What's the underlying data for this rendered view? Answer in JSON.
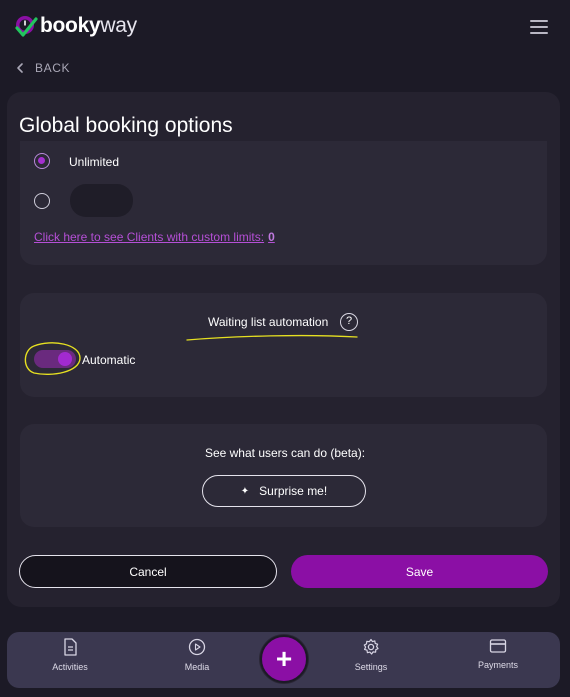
{
  "header": {
    "logo_bold": "booky",
    "logo_light": "way",
    "menu_icon": "hamburger-icon"
  },
  "nav": {
    "back_label": "BACK"
  },
  "page": {
    "title": "Global booking options"
  },
  "limits": {
    "options": [
      {
        "label": "Unlimited",
        "selected": true
      },
      {
        "label": "",
        "selected": false
      }
    ],
    "custom_link_text": "Click here to see Clients with custom limits:",
    "custom_link_count": "0"
  },
  "waiting_list": {
    "title": "Waiting list automation",
    "help_symbol": "?",
    "toggle_label": "Automatic",
    "toggle_on": true
  },
  "beta": {
    "prompt": "See what users can do (beta):",
    "surprise_label": "Surprise me!",
    "surprise_icon": "sparkle-icon"
  },
  "actions": {
    "cancel_label": "Cancel",
    "save_label": "Save"
  },
  "bottom_nav": {
    "items": [
      {
        "label": "Activities",
        "icon": "document-icon"
      },
      {
        "label": "Media",
        "icon": "play-icon"
      },
      {
        "label": "Settings",
        "icon": "gear-icon"
      },
      {
        "label": "Payments",
        "icon": "card-icon"
      }
    ],
    "fab_symbol": "+"
  },
  "colors": {
    "accent": "#8b0fa5",
    "background": "#1c1a26",
    "panel": "#25222f",
    "card": "#2c2937",
    "link": "#b54fd6",
    "annotation": "#e6e021"
  }
}
